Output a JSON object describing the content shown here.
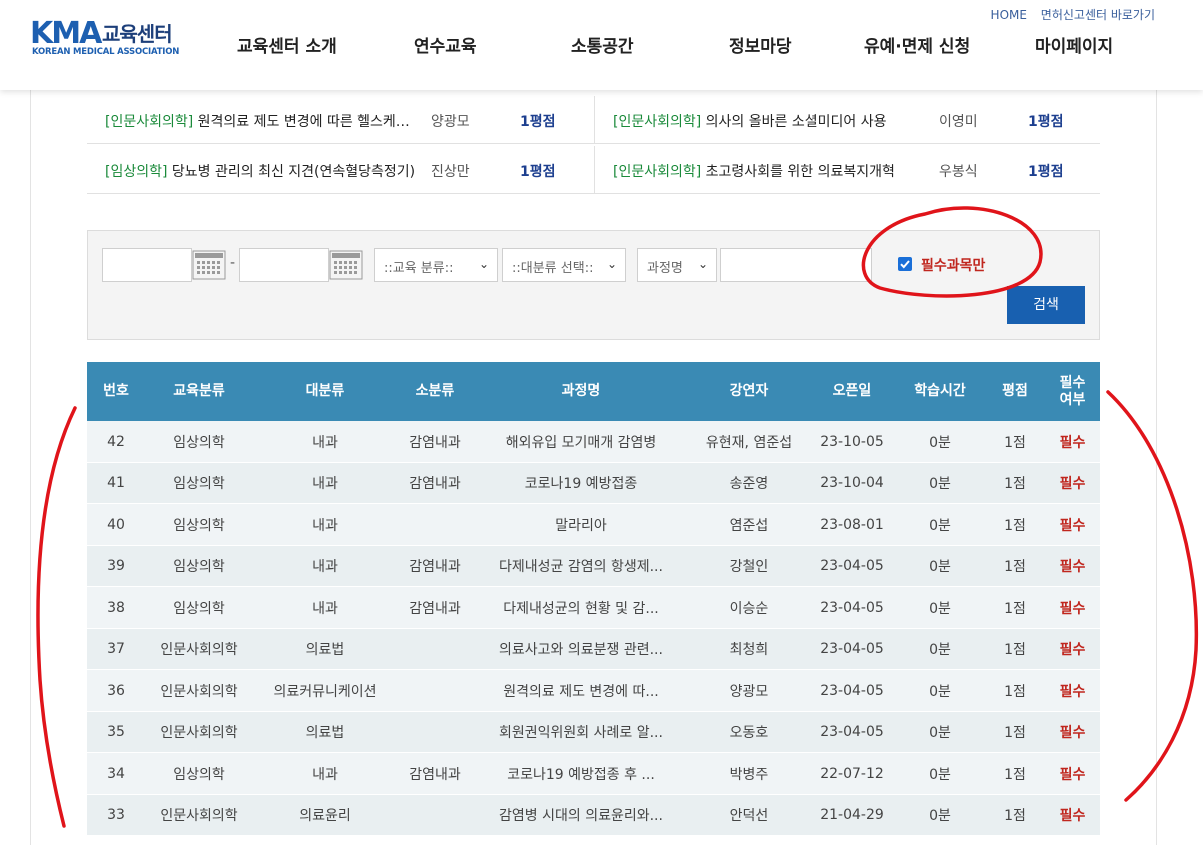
{
  "header": {
    "logo_main": "KMA",
    "logo_kr": "교육센터",
    "logo_sub": "KOREAN MEDICAL ASSOCIATION",
    "util": [
      "HOME",
      "면허신고센터 바로가기"
    ],
    "menu": [
      "교육센터 소개",
      "연수교육",
      "소통공간",
      "정보마당",
      "유예·면제 신청",
      "마이페이지"
    ]
  },
  "recommended": [
    [
      {
        "category": "[인문사회의학]",
        "title": " 원격의료 제도 변경에 따른 헬스케어 산업",
        "lecturer": "양광모",
        "points": "1평점"
      },
      {
        "category": "[인문사회의학]",
        "title": " 의사의 올바른 소셜미디어 사용",
        "lecturer": "이영미",
        "points": "1평점"
      }
    ],
    [
      {
        "category": "[임상의학]",
        "title": " 당뇨병 관리의 최신 지견(연속혈당측정기)",
        "lecturer": "진상만",
        "points": "1평점"
      },
      {
        "category": "[인문사회의학]",
        "title": " 초고령사회를 위한 의료복지개혁",
        "lecturer": "우봉식",
        "points": "1평점"
      }
    ]
  ],
  "search": {
    "date_separator": "-",
    "select_edu": "::교육 분류::",
    "select_major": "::대분류 선택::",
    "select_field": "과정명",
    "required_only_label": "필수과목만",
    "required_only_checked": true,
    "search_button": "검색"
  },
  "table": {
    "headers": [
      "번호",
      "교육분류",
      "대분류",
      "소분류",
      "과정명",
      "강연자",
      "오픈일",
      "학습시간",
      "평점",
      "필수\n여부"
    ],
    "rows": [
      [
        "42",
        "임상의학",
        "내과",
        "감염내과",
        "해외유입 모기매개 감염병",
        "유현재, 염준섭",
        "23-10-05",
        "0분",
        "1점",
        "필수"
      ],
      [
        "41",
        "임상의학",
        "내과",
        "감염내과",
        "코로나19 예방접종",
        "송준영",
        "23-10-04",
        "0분",
        "1점",
        "필수"
      ],
      [
        "40",
        "임상의학",
        "내과",
        "",
        "말라리아",
        "염준섭",
        "23-08-01",
        "0분",
        "1점",
        "필수"
      ],
      [
        "39",
        "임상의학",
        "내과",
        "감염내과",
        "다제내성균 감염의 항생제...",
        "강철인",
        "23-04-05",
        "0분",
        "1점",
        "필수"
      ],
      [
        "38",
        "임상의학",
        "내과",
        "감염내과",
        "다제내성균의 현황 및 감...",
        "이승순",
        "23-04-05",
        "0분",
        "1점",
        "필수"
      ],
      [
        "37",
        "인문사회의학",
        "의료법",
        "",
        "의료사고와 의료분쟁 관련...",
        "최청희",
        "23-04-05",
        "0분",
        "1점",
        "필수"
      ],
      [
        "36",
        "인문사회의학",
        "의료커뮤니케이션",
        "",
        "원격의료 제도 변경에 따...",
        "양광모",
        "23-04-05",
        "0분",
        "1점",
        "필수"
      ],
      [
        "35",
        "인문사회의학",
        "의료법",
        "",
        "회원권익위원회 사례로 알...",
        "오동호",
        "23-04-05",
        "0분",
        "1점",
        "필수"
      ],
      [
        "34",
        "임상의학",
        "내과",
        "감염내과",
        "코로나19 예방접종 후 ...",
        "박병주",
        "22-07-12",
        "0분",
        "1점",
        "필수"
      ],
      [
        "33",
        "인문사회의학",
        "의료윤리",
        "",
        "감염병 시대의 의료윤리와...",
        "안덕선",
        "21-04-29",
        "0분",
        "1점",
        "필수"
      ]
    ]
  },
  "colors": {
    "header_bg": "#3a8ab4",
    "brand": "#1d5fb0",
    "category_green": "#1a8a3a",
    "required_red": "#c0261e",
    "button_blue": "#1860b0",
    "annotation_red": "#e0141a"
  }
}
